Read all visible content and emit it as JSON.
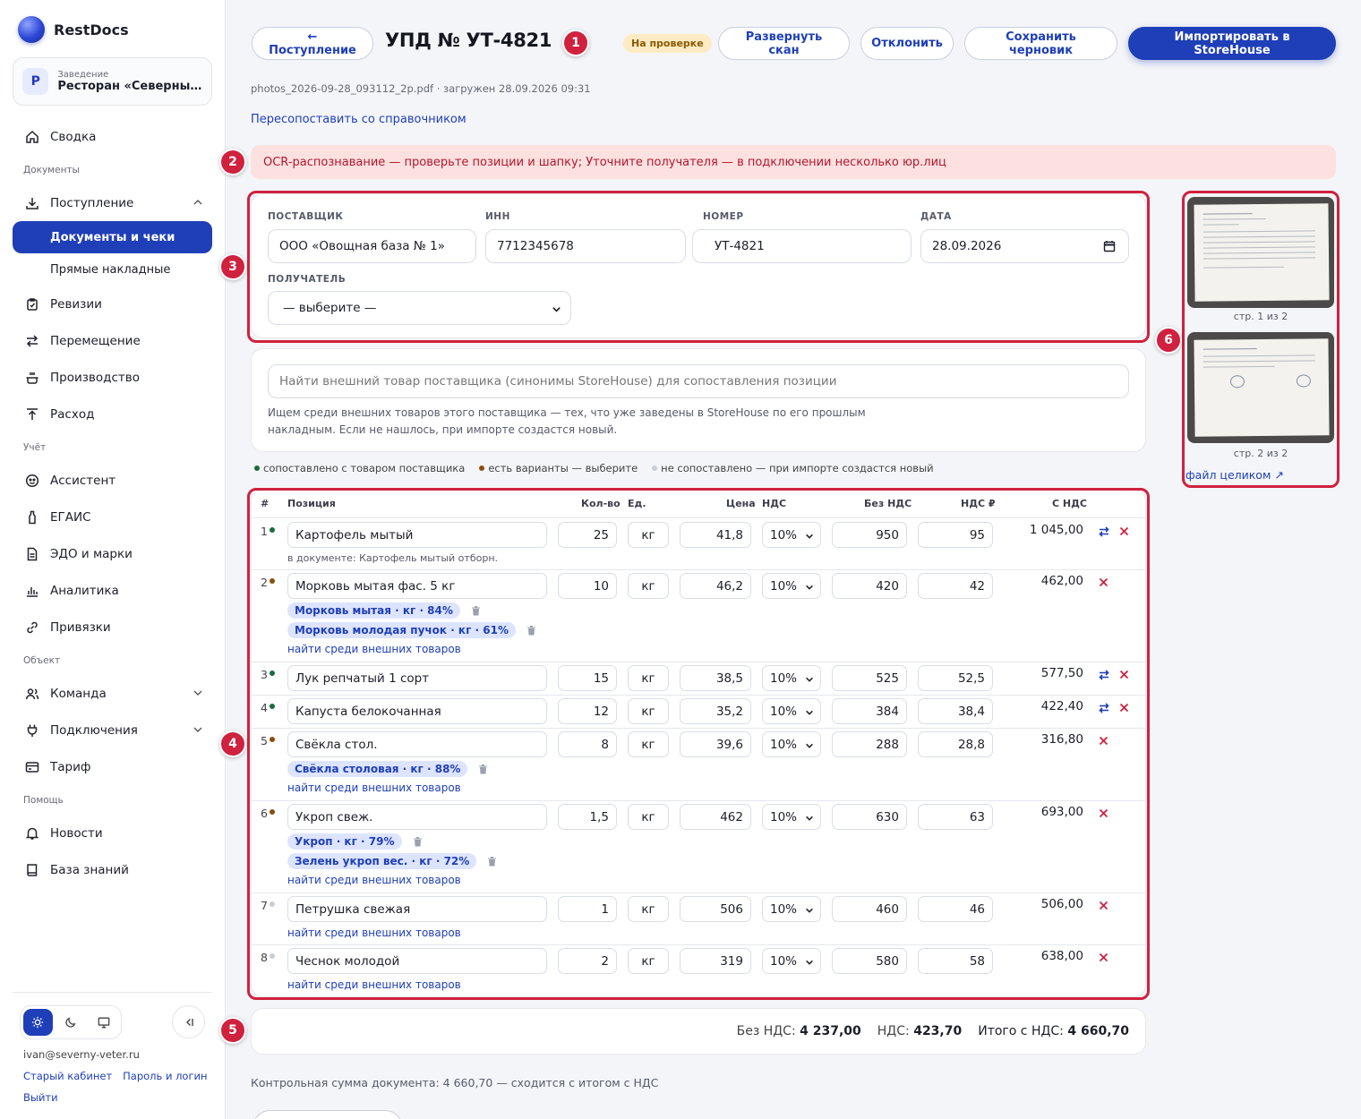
{
  "sidebar": {
    "brand": "RestDocs",
    "venue": {
      "avatar": "Р",
      "label": "Заведение",
      "name": "Ресторан «Северный ветер»"
    },
    "nav": {
      "summary": "Сводка",
      "sec_docs": "Документы",
      "incoming": "Поступление",
      "docs_checks": "Документы и чеки",
      "direct": "Прямые накладные",
      "revisions": "Ревизии",
      "transfer": "Перемещение",
      "production": "Производство",
      "expense": "Расход",
      "sec_account": "Учёт",
      "assistant": "Ассистент",
      "egais": "ЕГАИС",
      "edo": "ЭДО и марки",
      "analytics": "Аналитика",
      "bindings": "Привязки",
      "sec_object": "Объект",
      "team": "Команда",
      "connections": "Подключения",
      "tariff": "Тариф",
      "sec_help": "Помощь",
      "news": "Новости",
      "kb": "База знаний"
    },
    "footer": {
      "email": "ivan@severny-veter.ru",
      "old_cabinet": "Старый кабинет",
      "password": "Пароль и логин",
      "logout": "Выйти"
    }
  },
  "header": {
    "back": "← Поступление",
    "title": "УПД № УТ-4821",
    "status": "На проверке",
    "expand_scan": "Развернуть скан",
    "reject": "Отклонить",
    "save_draft": "Сохранить черновик",
    "import": "Импортировать в StoreHouse"
  },
  "file_info": "photos_2026-09-28_093112_2p.pdf · загружен 28.09.2026 09:31",
  "remap_link": "Пересопоставить со справочником",
  "alert": "OCR-распознавание — проверьте позиции и шапку; Уточните получателя — в подключении несколько юр.лиц",
  "form": {
    "supplier_label": "ПОСТАВЩИК",
    "supplier": "ООО «Овощная база № 1»",
    "inn_label": "ИНН",
    "inn": "7712345678",
    "number_label": "НОМЕР",
    "number": "УТ-4821",
    "date_label": "ДАТА",
    "date": "28.09.2026",
    "recipient_label": "ПОЛУЧАТЕЛЬ",
    "recipient": "— выберите —"
  },
  "search": {
    "placeholder": "Найти внешний товар поставщика (синонимы StoreHouse) для сопоставления позиции",
    "hint": "Ищем среди внешних товаров этого поставщика — тех, что уже заведены в StoreHouse по его прошлым накладным. Если не нашлось, при импорте создастся новый."
  },
  "legend": {
    "matched": "сопоставлено с товаром поставщика",
    "variants": "есть варианты — выберите",
    "unmatched": "не сопоставлено — при импорте создастся новый"
  },
  "table": {
    "headers": {
      "num": "#",
      "pos": "Позиция",
      "qty": "Кол-во",
      "unit": "Ед.",
      "price": "Цена",
      "vat": "НДС",
      "novat": "Без НДС",
      "vatrub": "НДС ₽",
      "withvat": "С НДС"
    },
    "find_link": "найти среди внешних товаров",
    "rows": [
      {
        "n": "1",
        "status": "matched",
        "name": "Картофель мытый",
        "qty": "25",
        "unit": "кг",
        "price": "41,8",
        "vat": "10%",
        "novat": "950",
        "vatrub": "95",
        "total": "1 045,00",
        "note": "в документе: Картофель мытый отборн."
      },
      {
        "n": "2",
        "status": "variants",
        "name": "Морковь мытая фас. 5 кг",
        "qty": "10",
        "unit": "кг",
        "price": "46,2",
        "vat": "10%",
        "novat": "420",
        "vatrub": "42",
        "total": "462,00",
        "chips": [
          "Морковь мытая · кг · 84%",
          "Морковь молодая пучок · кг · 61%"
        ]
      },
      {
        "n": "3",
        "status": "matched",
        "name": "Лук репчатый 1 сорт",
        "qty": "15",
        "unit": "кг",
        "price": "38,5",
        "vat": "10%",
        "novat": "525",
        "vatrub": "52,5",
        "total": "577,50"
      },
      {
        "n": "4",
        "status": "matched",
        "name": "Капуста белокочанная",
        "qty": "12",
        "unit": "кг",
        "price": "35,2",
        "vat": "10%",
        "novat": "384",
        "vatrub": "38,4",
        "total": "422,40"
      },
      {
        "n": "5",
        "status": "variants",
        "name": "Свёкла стол.",
        "qty": "8",
        "unit": "кг",
        "price": "39,6",
        "vat": "10%",
        "novat": "288",
        "vatrub": "28,8",
        "total": "316,80",
        "chips": [
          "Свёкла столовая · кг · 88%"
        ]
      },
      {
        "n": "6",
        "status": "variants",
        "name": "Укроп свеж.",
        "qty": "1,5",
        "unit": "кг",
        "price": "462",
        "vat": "10%",
        "novat": "630",
        "vatrub": "63",
        "total": "693,00",
        "chips": [
          "Укроп · кг · 79%",
          "Зелень укроп вес. · кг · 72%"
        ]
      },
      {
        "n": "7",
        "status": "unmatched",
        "name": "Петрушка свежая",
        "qty": "1",
        "unit": "кг",
        "price": "506",
        "vat": "10%",
        "novat": "460",
        "vatrub": "46",
        "total": "506,00"
      },
      {
        "n": "8",
        "status": "unmatched",
        "name": "Чеснок молодой",
        "qty": "2",
        "unit": "кг",
        "price": "319",
        "vat": "10%",
        "novat": "580",
        "vatrub": "58",
        "total": "638,00"
      }
    ]
  },
  "totals": {
    "novat_label": "Без НДС:",
    "novat": "4 237,00",
    "vat_label": "НДС:",
    "vat": "423,70",
    "total_label": "Итого с НДС:",
    "total": "4 660,70"
  },
  "control_sum": "Контрольная сумма документа: 4 660,70 — сходится с итогом с НДС",
  "pages": {
    "page1": "стр. 1 из 2",
    "page2": "стр. 2 из 2",
    "whole_file": "файл целиком ↗"
  },
  "markers": [
    "1",
    "2",
    "3",
    "4",
    "5",
    "6"
  ],
  "colors": {
    "accent": "#1f3fb8",
    "marker": "#d0213e",
    "matched": "#1a6b3a",
    "variants": "#8a4e0e",
    "unmatched": "#c9cdd6"
  }
}
